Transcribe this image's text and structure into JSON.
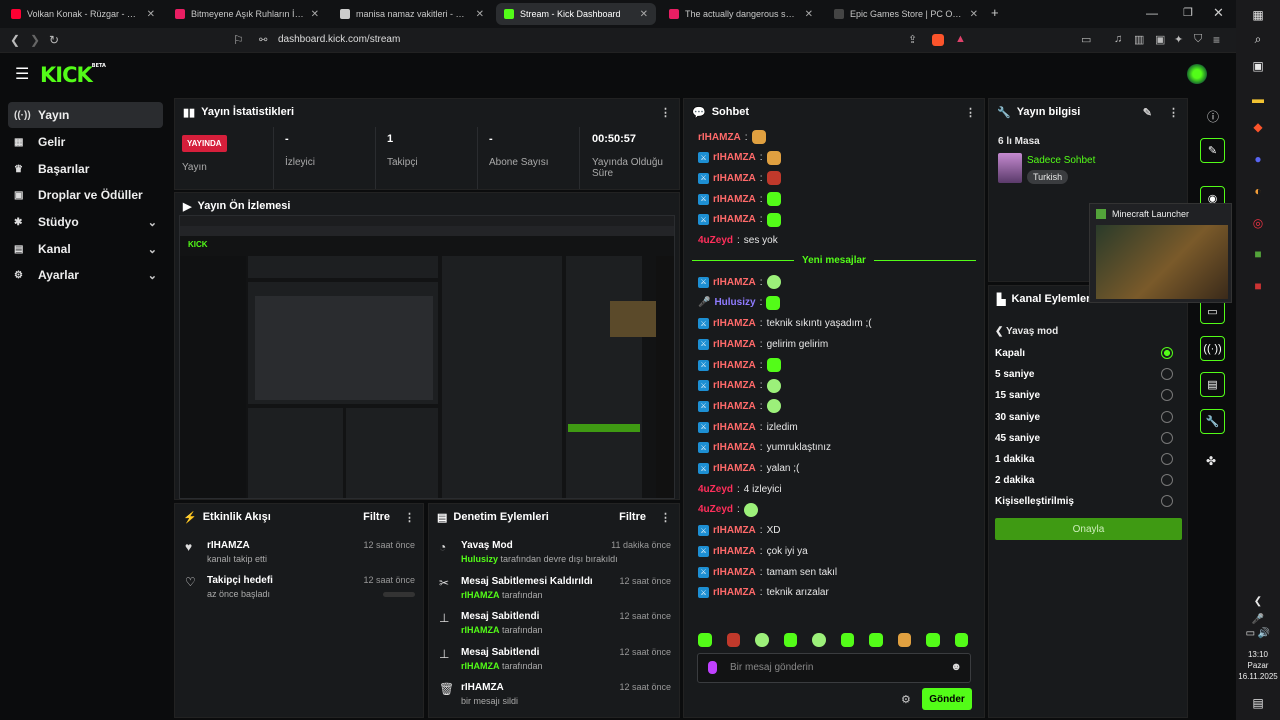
{
  "browser": {
    "tabs": [
      {
        "label": "Volkan Konak - Rüzgar - YouTube",
        "color": "#ff0033"
      },
      {
        "label": "Bitmeyene Aşık Ruhların İfadesi - Ön",
        "color": "#e91e63"
      },
      {
        "label": "manisa namaz vakitleri - Google'da A",
        "color": "#cccccc"
      },
      {
        "label": "Stream - Kick Dashboard",
        "color": "#53fc18"
      },
      {
        "label": "The actually dangerous sport! #moto",
        "color": "#e91e63"
      },
      {
        "label": "Epic Games Store | PC Oyunları, Mo",
        "color": "#444444"
      }
    ],
    "url": "dashboard.kick.com/stream"
  },
  "logo": "KICK",
  "logo_sup": "BETA",
  "sidebar": [
    {
      "label": "Yayın",
      "icon": "broadcast-icon",
      "glyph": "((·))"
    },
    {
      "label": "Gelir",
      "icon": "revenue-icon",
      "glyph": "▦"
    },
    {
      "label": "Başarılar",
      "icon": "trophy-icon",
      "glyph": "♛"
    },
    {
      "label": "Droplar ve Ödüller",
      "icon": "gift-icon",
      "glyph": "▣"
    },
    {
      "label": "Stüdyo",
      "icon": "studio-icon",
      "glyph": "✱"
    },
    {
      "label": "Kanal",
      "icon": "channel-icon",
      "glyph": "▤"
    },
    {
      "label": "Ayarlar",
      "icon": "settings-icon",
      "glyph": "⚙"
    }
  ],
  "stats": {
    "title": "Yayın İstatistikleri",
    "badge": "YAYINDA",
    "items": [
      {
        "value": "",
        "label": "Yayın"
      },
      {
        "value": "-",
        "label": "İzleyici"
      },
      {
        "value": "1",
        "label": "Takipçi"
      },
      {
        "value": "-",
        "label": "Abone Sayısı"
      },
      {
        "value": "00:50:57",
        "label": "Yayında Olduğu Süre"
      }
    ]
  },
  "preview": {
    "title": "Yayın Ön İzlemesi"
  },
  "activity": {
    "title": "Etkinlik Akışı",
    "filter": "Filtre",
    "items": [
      {
        "title": "rIHAMZA",
        "sub": "kanalı takip etti",
        "time": "12 saat önce",
        "icon": "heart-icon",
        "glyph": "♥"
      },
      {
        "title": "Takipçi hedefi",
        "sub": "az önce başladı",
        "time": "12 saat önce",
        "icon": "heart-outline-icon",
        "glyph": "♡"
      }
    ]
  },
  "moderation": {
    "title": "Denetim Eylemleri",
    "filter": "Filtre",
    "items": [
      {
        "title": "Yavaş Mod",
        "user": "Hulusizy",
        "sub": "tarafından devre dışı bırakıldı",
        "time": "11 dakika önce",
        "icon": "slow-mode-icon",
        "glyph": "◔"
      },
      {
        "title": "Mesaj Sabitlemesi Kaldırıldı",
        "user": "rIHAMZA",
        "sub": "tarafından",
        "time": "12 saat önce",
        "icon": "unpin-icon",
        "glyph": "✂"
      },
      {
        "title": "Mesaj Sabitlendi",
        "user": "rIHAMZA",
        "sub": "tarafından",
        "time": "12 saat önce",
        "icon": "pin-icon",
        "glyph": "⊥"
      },
      {
        "title": "Mesaj Sabitlendi",
        "user": "rIHAMZA",
        "sub": "tarafından",
        "time": "12 saat önce",
        "icon": "pin-icon",
        "glyph": "⊥"
      },
      {
        "title": "rIHAMZA",
        "user": "",
        "sub": "bir mesajı sildi",
        "time": "12 saat önce",
        "icon": "trash-icon",
        "glyph": "🗑"
      }
    ]
  },
  "chat": {
    "title": "Sohbet",
    "new_messages": "Yeni mesajlar",
    "messages": [
      {
        "user": "rIHAMZA",
        "color": "#ff6a6a",
        "text": "",
        "emote": "orange",
        "mod": false
      },
      {
        "user": "rIHAMZA",
        "color": "#ff6a6a",
        "text": "",
        "emote": "orange",
        "mod": true
      },
      {
        "user": "rIHAMZA",
        "color": "#ff6a6a",
        "text": "",
        "emote": "red",
        "mod": true
      },
      {
        "user": "rIHAMZA",
        "color": "#ff6a6a",
        "text": "",
        "emote": "green",
        "mod": true
      },
      {
        "user": "rIHAMZA",
        "color": "#ff6a6a",
        "text": "",
        "emote": "green",
        "mod": true
      },
      {
        "user": "4uZeyd",
        "color": "#ff2f5b",
        "text": "ses yok",
        "emote": "",
        "mod": false
      },
      {
        "user": "rIHAMZA",
        "color": "#ff6a6a",
        "text": "",
        "emote": "face",
        "mod": true
      },
      {
        "user": "Hulusizy",
        "color": "#8f7bff",
        "text": "",
        "emote": "green",
        "mod": false
      },
      {
        "user": "rIHAMZA",
        "color": "#ff6a6a",
        "text": "teknik sıkıntı yaşadım ;(",
        "emote": "",
        "mod": true
      },
      {
        "user": "rIHAMZA",
        "color": "#ff6a6a",
        "text": "gelirim gelirim",
        "emote": "",
        "mod": true
      },
      {
        "user": "rIHAMZA",
        "color": "#ff6a6a",
        "text": "",
        "emote": "green",
        "mod": true
      },
      {
        "user": "rIHAMZA",
        "color": "#ff6a6a",
        "text": "",
        "emote": "face",
        "mod": true
      },
      {
        "user": "rIHAMZA",
        "color": "#ff6a6a",
        "text": "",
        "emote": "face",
        "mod": true
      },
      {
        "user": "rIHAMZA",
        "color": "#ff6a6a",
        "text": "izledim",
        "emote": "",
        "mod": true
      },
      {
        "user": "rIHAMZA",
        "color": "#ff6a6a",
        "text": "yumruklaştınız",
        "emote": "",
        "mod": true
      },
      {
        "user": "rIHAMZA",
        "color": "#ff6a6a",
        "text": "yalan ;(",
        "emote": "",
        "mod": true
      },
      {
        "user": "4uZeyd",
        "color": "#ff2f5b",
        "text": "4 izleyici",
        "emote": "",
        "mod": false
      },
      {
        "user": "4uZeyd",
        "color": "#ff2f5b",
        "text": "",
        "emote": "face",
        "mod": false
      },
      {
        "user": "rIHAMZA",
        "color": "#ff6a6a",
        "text": "XD",
        "emote": "",
        "mod": true
      },
      {
        "user": "rIHAMZA",
        "color": "#ff6a6a",
        "text": "çok iyi ya",
        "emote": "",
        "mod": true
      },
      {
        "user": "rIHAMZA",
        "color": "#ff6a6a",
        "text": "tamam sen takıl",
        "emote": "",
        "mod": true
      },
      {
        "user": "rIHAMZA",
        "color": "#ff6a6a",
        "text": "teknik arızalar",
        "emote": "",
        "mod": true
      }
    ],
    "input_placeholder": "Bir mesaj gönderin",
    "send": "Gönder"
  },
  "stream_info": {
    "title": "Yayın bilgisi",
    "stream_title": "6 lı Masa",
    "category": "Sadece Sohbet",
    "language": "Turkish"
  },
  "channel_actions": {
    "title": "Kanal Eylemleri",
    "sub": "Yavaş mod",
    "options": [
      "Kapalı",
      "5 saniye",
      "15 saniye",
      "30 saniye",
      "45 saniye",
      "1 dakika",
      "2 dakika",
      "Kişiselleştirilmiş"
    ],
    "selected": 0,
    "confirm": "Onayla"
  },
  "popup": {
    "title": "Minecraft Launcher"
  },
  "clock": {
    "time": "13:10",
    "day": "Pazar",
    "date": "16.11.2025"
  }
}
